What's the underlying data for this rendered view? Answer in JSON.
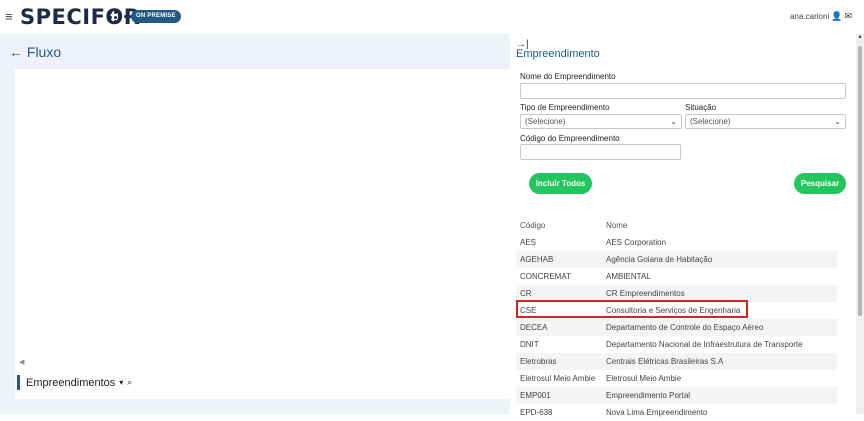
{
  "header": {
    "logo_text": "SPECIFOR",
    "badge": "ON PREMISE",
    "user": "ana.carioni",
    "menu_icon": "hamburger-icon",
    "user_icons": [
      "user-icon",
      "mail-icon"
    ]
  },
  "left": {
    "back_label": "← Fluxo",
    "scroll_arrow": "◀",
    "bottom_label": "Empreendimentos",
    "caret": "▾",
    "search_glyph": "🔍"
  },
  "panel": {
    "pin_glyph": "→|",
    "title": "Empreendimento",
    "nome_label": "Nome do Empreendimento",
    "tipo_label": "Tipo de Empreendimento",
    "situacao_label": "Situação",
    "tipo_value": "(Selecione)",
    "situacao_value": "(Selecione)",
    "codigo_label": "Código do Empreendimento",
    "incluir_button": "Incluir Todos",
    "pesquisar_button": "Pesquisar",
    "columns": [
      "Código",
      "Nome"
    ],
    "rows": [
      [
        "AES",
        "AES Corporation"
      ],
      [
        "AGEHAB",
        "Agência Goiana de Habitação"
      ],
      [
        "CONCREMAT",
        "AMBIENTAL"
      ],
      [
        "CR",
        "CR Empreendimentos"
      ],
      [
        "CSE",
        "Consultoria e Serviços de Engenharia"
      ],
      [
        "DECEA",
        "Departamento de Controle do Espaço Aéreo"
      ],
      [
        "DNIT",
        "Departamento Nacional de Infraestrutura de Transporte"
      ],
      [
        "Eletrobras",
        "Centrais Elétricas Brasileiras S.A"
      ],
      [
        "Eletrosul Meio Ambie",
        "Eletrosul Meio Ambie"
      ],
      [
        "EMP001",
        "Empreendimento Portal"
      ],
      [
        "EPD-638",
        "Nova Lima Empreendimento"
      ]
    ]
  },
  "colors": {
    "brand": "#1f5a84",
    "button_green": "#22c55e",
    "highlight_red": "#e02020"
  }
}
